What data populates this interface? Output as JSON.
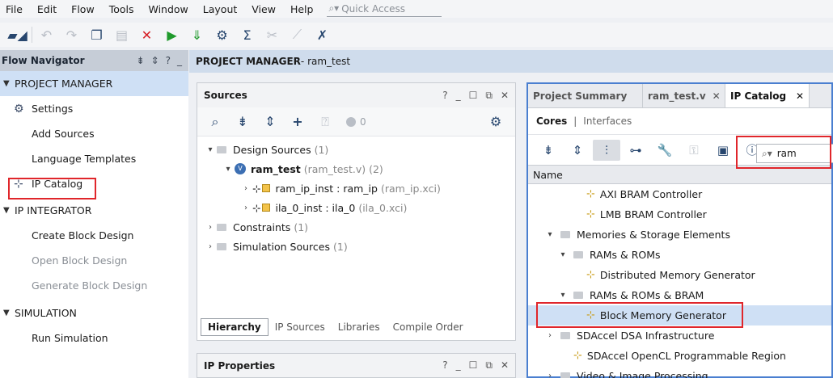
{
  "menu": [
    "File",
    "Edit",
    "Flow",
    "Tools",
    "Window",
    "Layout",
    "View",
    "Help"
  ],
  "quick_access_placeholder": "Quick Access",
  "toolbar_icons": [
    "open-project-icon",
    "undo-icon",
    "redo-icon",
    "copy-icon",
    "paste-icon",
    "delete-icon",
    "run-icon",
    "download-icon",
    "settings-icon",
    "sigma-icon",
    "disabled-tool-icon",
    "disabled-tool2-icon",
    "cancel-tool-icon"
  ],
  "flow_navigator": {
    "title": "Flow Navigator",
    "sections": [
      {
        "label": "PROJECT MANAGER",
        "items": [
          "Settings",
          "Add Sources",
          "Language Templates",
          "IP Catalog"
        ]
      },
      {
        "label": "IP INTEGRATOR",
        "items": [
          "Create Block Design",
          "Open Block Design",
          "Generate Block Design"
        ]
      },
      {
        "label": "SIMULATION",
        "items": [
          "Run Simulation"
        ]
      }
    ]
  },
  "pm_header": {
    "title": "PROJECT MANAGER",
    "suffix": " - ram_test"
  },
  "sources": {
    "title": "Sources",
    "badge_count": "0",
    "tree": {
      "design_sources": "Design Sources",
      "design_sources_count": "(1)",
      "top_name": "ram_test",
      "top_meta": "(ram_test.v) (2)",
      "children": [
        {
          "name": "ram_ip_inst : ram_ip",
          "meta": "(ram_ip.xci)"
        },
        {
          "name": "ila_0_inst : ila_0",
          "meta": "(ila_0.xci)"
        }
      ],
      "constraints": "Constraints",
      "constraints_count": "(1)",
      "simulation": "Simulation Sources",
      "simulation_count": "(1)"
    },
    "tabs": [
      "Hierarchy",
      "IP Sources",
      "Libraries",
      "Compile Order"
    ]
  },
  "ip_properties": {
    "title": "IP Properties"
  },
  "right_panel": {
    "tabs": [
      "Project Summary",
      "ram_test.v",
      "IP Catalog"
    ],
    "subtabs": {
      "cores": "Cores",
      "sep": "|",
      "interfaces": "Interfaces"
    },
    "search_value": "ram",
    "column_header": "Name",
    "rows": [
      {
        "label": "AXI BRAM Controller"
      },
      {
        "label": "LMB BRAM Controller"
      },
      {
        "label": "Memories & Storage Elements"
      },
      {
        "label": "RAMs & ROMs"
      },
      {
        "label": "Distributed Memory Generator"
      },
      {
        "label": "RAMs & ROMs & BRAM"
      },
      {
        "label": "Block Memory Generator"
      },
      {
        "label": "SDAccel DSA Infrastructure"
      },
      {
        "label": "SDAccel OpenCL Programmable Region"
      },
      {
        "label": "Video & Image Processing"
      }
    ]
  },
  "colors": {
    "highlight": "#e0262b",
    "selection": "#cfe0f5",
    "panel_border": "#4a7fd0"
  }
}
